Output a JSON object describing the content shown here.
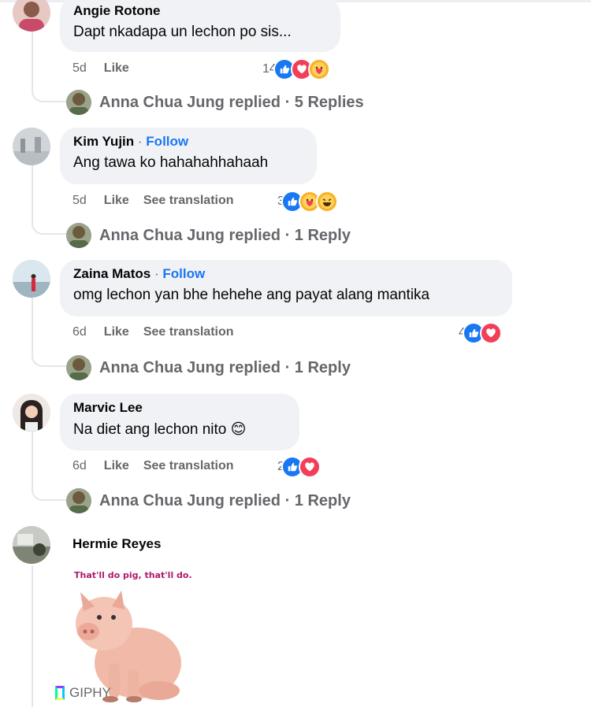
{
  "comments": [
    {
      "name": "Angie Rotone",
      "follow": "",
      "text": "Dapt nkadapa un lechon po sis...",
      "age": "5d",
      "like": "Like",
      "translate": "",
      "reactions": "14",
      "reaction_icons": [
        "like-icon",
        "love-icon",
        "care-icon"
      ],
      "reply_text": "Anna Chua Jung replied · 5 Replies"
    },
    {
      "name": "Kim Yujin",
      "follow": "Follow",
      "text": "Ang tawa ko hahahahhahaah",
      "age": "5d",
      "like": "Like",
      "translate": "See translation",
      "reactions": "3",
      "reaction_icons": [
        "like-icon",
        "care-icon",
        "haha-icon"
      ],
      "reply_text": "Anna Chua Jung replied · 1 Reply"
    },
    {
      "name": "Zaina Matos",
      "follow": "Follow",
      "text": "omg lechon yan bhe hehehe ang payat alang mantika",
      "age": "6d",
      "like": "Like",
      "translate": "See translation",
      "reactions": "4",
      "reaction_icons": [
        "like-icon",
        "love-icon"
      ],
      "reply_text": "Anna Chua Jung replied · 1 Reply"
    },
    {
      "name": "Marvic Lee",
      "follow": "",
      "text": "Na diet ang lechon nito 😊",
      "age": "6d",
      "like": "Like",
      "translate": "See translation",
      "reactions": "2",
      "reaction_icons": [
        "like-icon",
        "love-icon"
      ],
      "reply_text": "Anna Chua Jung replied · 1 Reply"
    }
  ],
  "last_comment": {
    "name": "Hermie Reyes",
    "gif_caption": "That'll do pig, that'll do.",
    "giphy_label": "GIPHY"
  },
  "follow_separator": "·",
  "colors": {
    "link": "#1877f2",
    "muted": "#65676b",
    "bubble": "#f0f2f5",
    "like": "#1877f2",
    "love": "#f33e58",
    "care": "#f7b125"
  }
}
